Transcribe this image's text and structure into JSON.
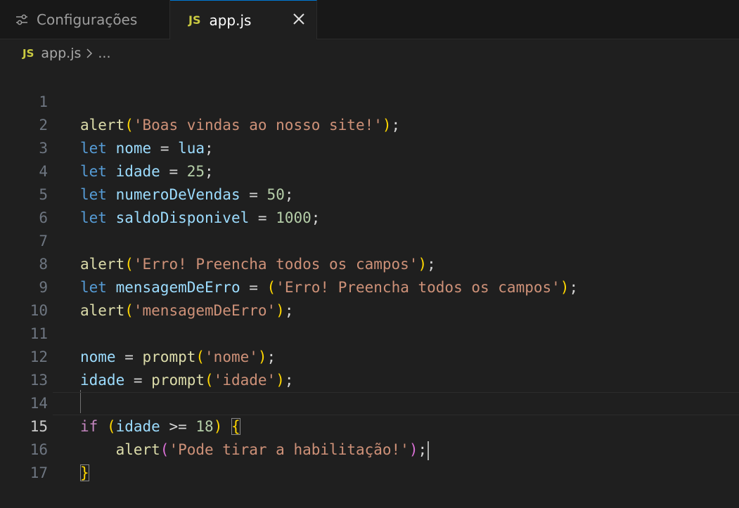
{
  "tabs": [
    {
      "label": "Configurações",
      "icon": "settings-sliders-icon",
      "active": false
    },
    {
      "label": "app.js",
      "icon": "js-file-icon",
      "active": true,
      "badge": "JS"
    }
  ],
  "breadcrumb": {
    "badge": "JS",
    "file": "app.js",
    "more": "..."
  },
  "editor": {
    "current_line": 15,
    "line_numbers": [
      "1",
      "2",
      "3",
      "4",
      "5",
      "6",
      "7",
      "8",
      "9",
      "10",
      "11",
      "12",
      "13",
      "14",
      "15",
      "16",
      "17"
    ]
  },
  "code": {
    "l1": {
      "fn": "alert",
      "open": "(",
      "str": "'Boas vindas ao nosso site!'",
      "close": ")",
      "semi": ";"
    },
    "l2": {
      "kw": "let",
      "var": "nome",
      "eq": " = ",
      "val": "lua",
      "semi": ";"
    },
    "l3": {
      "kw": "let",
      "var": "idade",
      "eq": " = ",
      "num": "25",
      "semi": ";"
    },
    "l4": {
      "kw": "let",
      "var": "numeroDeVendas",
      "eq": " = ",
      "num": "50",
      "semi": ";"
    },
    "l5": {
      "kw": "let",
      "var": "saldoDisponivel",
      "eq": " = ",
      "num": "1000",
      "semi": ";"
    },
    "l7": {
      "fn": "alert",
      "open": "(",
      "str": "'Erro! Preencha todos os campos'",
      "close": ")",
      "semi": ";"
    },
    "l8": {
      "kw": "let",
      "var": "mensagemDeErro",
      "eq": " = ",
      "open": "(",
      "str": "'Erro! Preencha todos os campos'",
      "close": ")",
      "semi": ";"
    },
    "l9": {
      "fn": "alert",
      "open": "(",
      "str": "'mensagemDeErro'",
      "close": ")",
      "semi": ";"
    },
    "l11": {
      "var": "nome",
      "eq": " = ",
      "fn": "prompt",
      "open": "(",
      "str": "'nome'",
      "close": ")",
      "semi": ";"
    },
    "l12": {
      "var": "idade",
      "eq": " = ",
      "fn": "prompt",
      "open": "(",
      "str": "'idade'",
      "close": ")",
      "semi": ";"
    },
    "l14": {
      "kw": "if",
      "open": "(",
      "var": "idade",
      "op": " >= ",
      "num": "18",
      "close": ")",
      "brace": "{"
    },
    "l15": {
      "indent": "    ",
      "fn": "alert",
      "open": "(",
      "str": "'Pode tirar a habilitação!'",
      "close": ")",
      "semi": ";"
    },
    "l16": {
      "brace": "}"
    }
  },
  "colors": {
    "background": "#1f1f1f",
    "tabbar": "#181818",
    "keyword": "#569cd6",
    "control_keyword": "#c586c0",
    "function": "#dcdcaa",
    "variable": "#9cdcfe",
    "string": "#ce9178",
    "number": "#b5cea8",
    "bracket_level1": "#ffd700",
    "bracket_level2": "#da70d6",
    "js_badge": "#cbcb41"
  }
}
